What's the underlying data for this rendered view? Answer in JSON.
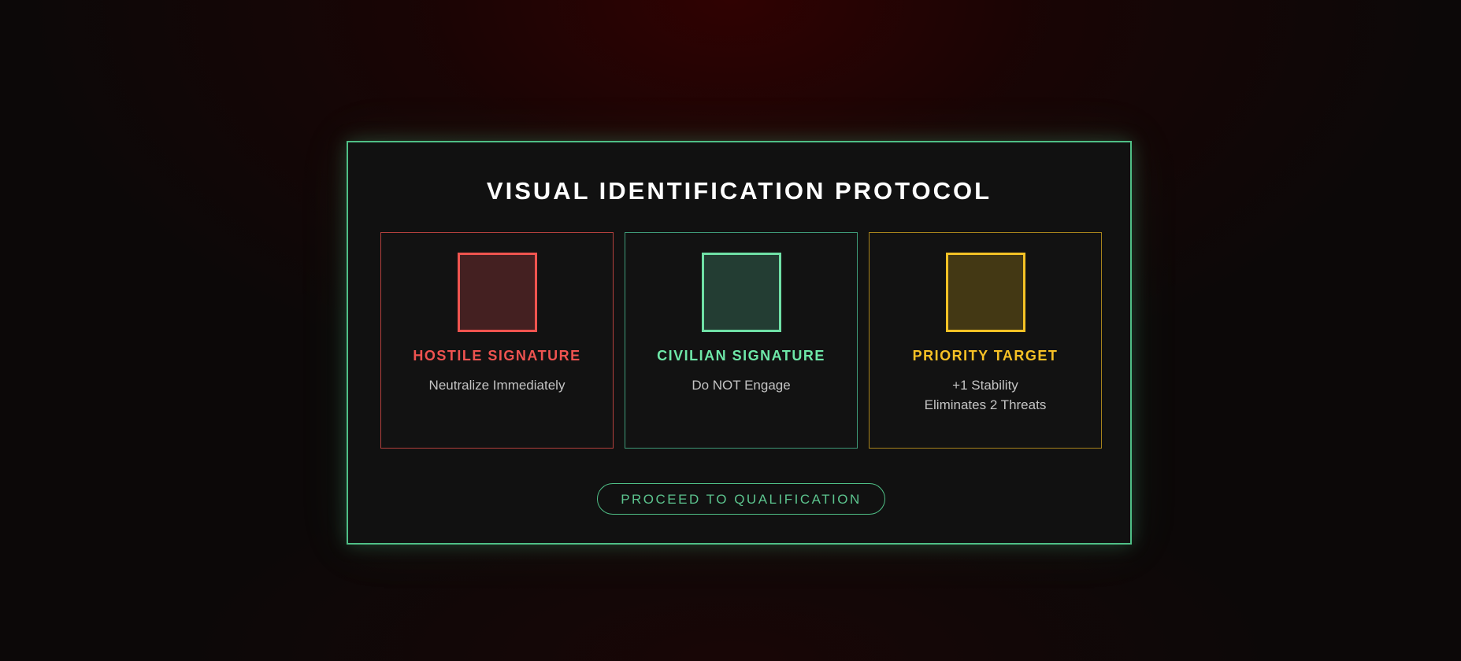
{
  "panel": {
    "title": "VISUAL IDENTIFICATION PROTOCOL"
  },
  "cards": [
    {
      "label": "HOSTILE SIGNATURE",
      "description_lines": [
        "Neutralize Immediately"
      ],
      "accent_color": "#ef5350"
    },
    {
      "label": "CIVILIAN SIGNATURE",
      "description_lines": [
        "Do NOT Engage"
      ],
      "accent_color": "#6ee7a8"
    },
    {
      "label": "PRIORITY TARGET",
      "description_lines": [
        "+1 Stability",
        "Eliminates 2 Threats"
      ],
      "accent_color": "#f7c125"
    }
  ],
  "actions": {
    "proceed_label": "PROCEED TO QUALIFICATION"
  },
  "colors": {
    "panel_border": "#4fbf86",
    "background": "#0c0808"
  }
}
